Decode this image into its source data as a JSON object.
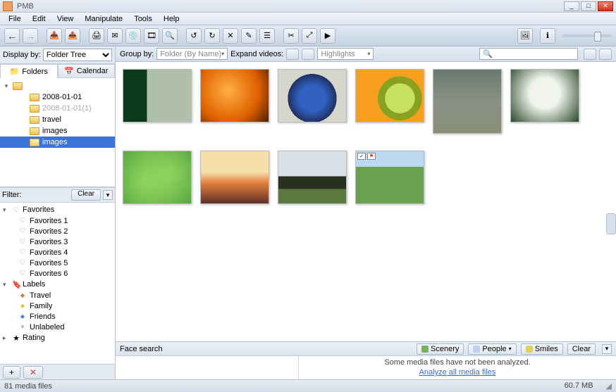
{
  "title": "PMB",
  "menu": [
    "File",
    "Edit",
    "View",
    "Manipulate",
    "Tools",
    "Help"
  ],
  "displayBy": {
    "label": "Display by:",
    "value": "Folder Tree"
  },
  "tabs": {
    "folders": "Folders",
    "calendar": "Calendar"
  },
  "tree": {
    "root": "",
    "items": [
      {
        "label": "2008-01-01",
        "muted": false
      },
      {
        "label": "2008-01-01(1)",
        "muted": true
      },
      {
        "label": "travel",
        "muted": false
      },
      {
        "label": "images",
        "muted": false
      },
      {
        "label": "images",
        "selected": true
      }
    ]
  },
  "filter": {
    "label": "Filter:",
    "clear": "Clear"
  },
  "favorites": {
    "heading": "Favorites",
    "items": [
      "Favorites 1",
      "Favorites 2",
      "Favorites 3",
      "Favorites 4",
      "Favorites 5",
      "Favorites 6"
    ]
  },
  "labels": {
    "heading": "Labels",
    "items": [
      {
        "label": "Travel",
        "cls": "orange"
      },
      {
        "label": "Family",
        "cls": "yellow"
      },
      {
        "label": "Friends",
        "cls": "blue"
      },
      {
        "label": "Unlabeled",
        "cls": "gray"
      }
    ]
  },
  "rating": {
    "heading": "Rating"
  },
  "groupBar": {
    "groupBy": "Group by:",
    "groupValue": "Folder (By Name)",
    "expandVideos": "Expand videos:",
    "highlights": "Highlights"
  },
  "faceSearch": {
    "label": "Face search",
    "scenery": "Scenery",
    "people": "People",
    "smiles": "Smiles",
    "clear": "Clear"
  },
  "analyze": {
    "msg": "Some media files have not been analyzed.",
    "link": "Analyze all media files"
  },
  "status": {
    "left": "81 media files",
    "right": "60.7 MB"
  },
  "addBtn": "+"
}
